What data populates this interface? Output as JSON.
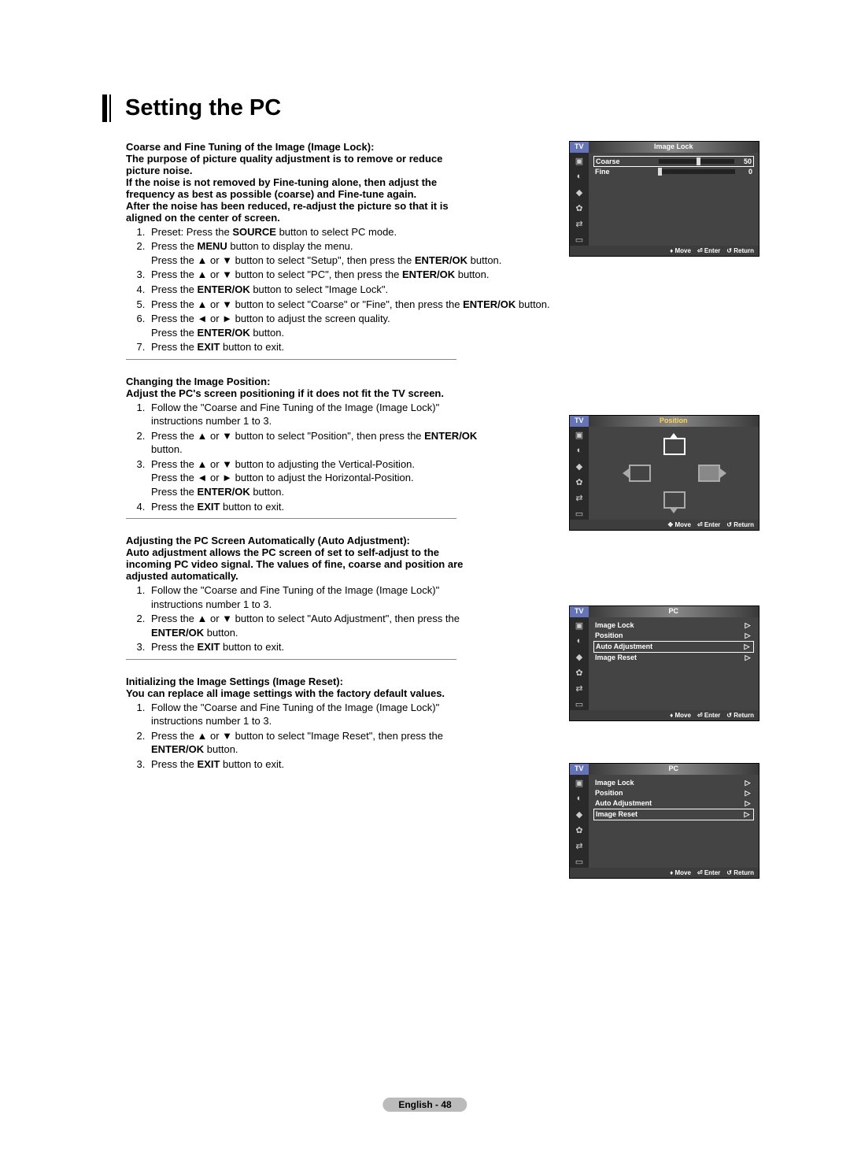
{
  "page_title": "Setting the PC",
  "footer": "English - 48",
  "section1": {
    "heading": "Coarse and Fine Tuning of the Image (Image Lock):\nThe purpose of picture quality adjustment is to remove or reduce picture noise.\nIf the noise is not removed by Fine-tuning alone, then adjust the frequency as best as possible (coarse) and Fine-tune again.\nAfter the noise has been reduced, re-adjust the picture so that it is aligned on the center of screen.",
    "steps": {
      "s1a": "Preset: Press the ",
      "s1b": "SOURCE",
      "s1c": " button to select PC mode.",
      "s2a": "Press the ",
      "s2b": "MENU",
      "s2c": " button to display the menu.\nPress the ▲ or ▼ button to select \"Setup\", then press the ",
      "s2d": "ENTER/OK",
      "s2e": " button.",
      "s3a": "Press the ▲ or ▼ button to select \"PC\", then press the ",
      "s3b": "ENTER/OK",
      "s3c": " button.",
      "s4a": "Press the ",
      "s4b": "ENTER/OK",
      "s4c": " button to select \"Image Lock\".",
      "s5a": "Press the ▲ or ▼ button to select \"Coarse\" or \"Fine\", then press the ",
      "s5b": "ENTER/OK",
      "s5c": " button.",
      "s6a": "Press the ◄ or ► button to adjust the screen quality.\nPress the ",
      "s6b": "ENTER/OK",
      "s6c": " button.",
      "s7a": "Press the ",
      "s7b": "EXIT",
      "s7c": " button to exit."
    }
  },
  "section2": {
    "heading": "Changing the Image Position:\nAdjust the PC's screen positioning if it does not fit the TV screen.",
    "steps": {
      "s1": "Follow the \"Coarse and Fine Tuning of the Image (Image Lock)\" instructions number 1 to 3.",
      "s2a": "Press the ▲ or ▼ button to select \"Position\", then press the ",
      "s2b": "ENTER/OK",
      "s2c": " button.",
      "s3a": "Press the ▲ or ▼ button to adjusting the Vertical-Position.\nPress the ◄ or ► button to adjust the Horizontal-Position.\nPress the ",
      "s3b": "ENTER/OK",
      "s3c": " button.",
      "s4a": "Press the ",
      "s4b": "EXIT",
      "s4c": " button to exit."
    }
  },
  "section3": {
    "heading": "Adjusting the PC Screen Automatically (Auto Adjustment):\nAuto adjustment allows the PC screen of set to self-adjust to the incoming PC video signal. The values of fine, coarse and position are adjusted automatically.",
    "steps": {
      "s1": "Follow the \"Coarse and Fine Tuning of the Image (Image Lock)\" instructions number 1 to 3.",
      "s2a": "Press the ▲ or ▼ button to select \"Auto Adjustment\", then press the ",
      "s2b": "ENTER/OK",
      "s2c": " button.",
      "s3a": "Press the ",
      "s3b": "EXIT",
      "s3c": " button to exit."
    }
  },
  "section4": {
    "heading": "Initializing the Image Settings (Image Reset):\nYou can replace all image settings with the factory default values.",
    "steps": {
      "s1": "Follow the \"Coarse and Fine Tuning of the Image (Image Lock)\" instructions number 1 to 3.",
      "s2a": "Press the ▲ or ▼ button to select \"Image Reset\", then press the ",
      "s2b": "ENTER/OK",
      "s2c": " button.",
      "s3a": "Press the ",
      "s3b": "EXIT",
      "s3c": " button to exit."
    }
  },
  "osd": {
    "tv": "TV",
    "move": "Move",
    "enter": "Enter",
    "return": "Return",
    "imagelock": {
      "title": "Image Lock",
      "coarse": "Coarse",
      "coarse_val": "50",
      "fine": "Fine",
      "fine_val": "0"
    },
    "position": {
      "title": "Position"
    },
    "pc": {
      "title": "PC",
      "items": [
        "Image Lock",
        "Position",
        "Auto Adjustment",
        "Image Reset"
      ]
    }
  }
}
